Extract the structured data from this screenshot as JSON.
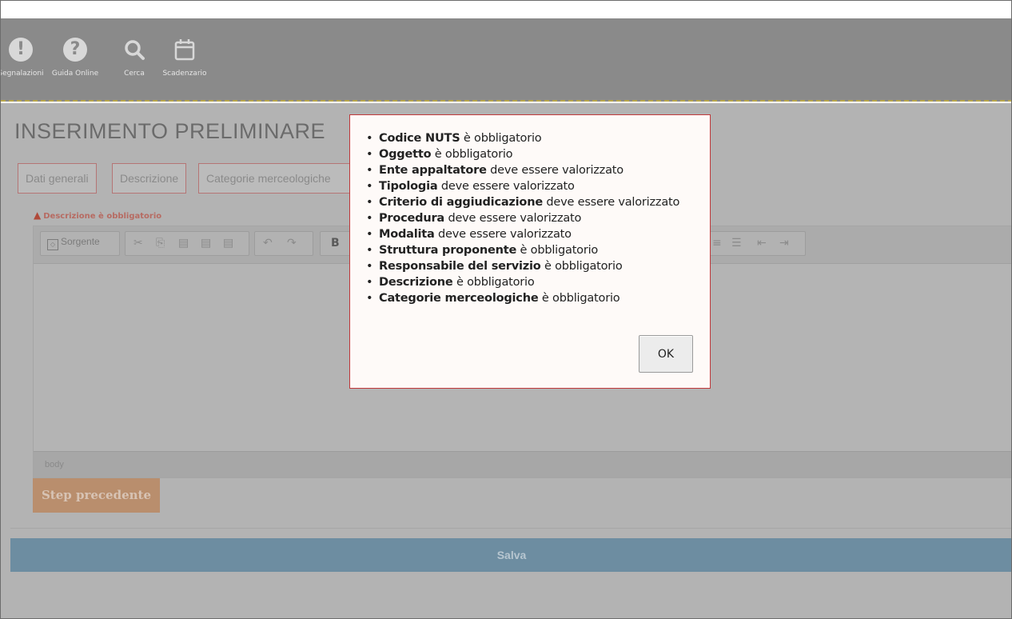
{
  "toolbar": {
    "items": [
      {
        "label": "Segnalazioni",
        "icon": "exclamation-icon"
      },
      {
        "label": "Guida Online",
        "icon": "question-icon"
      },
      {
        "label": "Cerca",
        "icon": "search-icon"
      },
      {
        "label": "Scadenzario",
        "icon": "calendar-icon"
      }
    ]
  },
  "page": {
    "title": "INSERIMENTO PRELIMINARE",
    "tabs": [
      {
        "label": "Dati generali"
      },
      {
        "label": "Descrizione"
      },
      {
        "label": "Categorie merceologiche"
      }
    ],
    "field_error": "Descrizione è obbligatorio",
    "editor": {
      "source_button": "Sorgente",
      "bold_label": "B",
      "status_path": "body"
    },
    "prev_button": "Step precedente",
    "save_button": "Salva"
  },
  "modal": {
    "errors": [
      {
        "field": "Codice NUTS",
        "message": "è obbligatorio"
      },
      {
        "field": "Oggetto",
        "message": "è obbligatorio"
      },
      {
        "field": "Ente appaltatore",
        "message": "deve essere valorizzato"
      },
      {
        "field": "Tipologia",
        "message": "deve essere valorizzato"
      },
      {
        "field": "Criterio di aggiudicazione",
        "message": "deve essere valorizzato"
      },
      {
        "field": "Procedura",
        "message": "deve essere valorizzato"
      },
      {
        "field": "Modalita",
        "message": "deve essere valorizzato"
      },
      {
        "field": "Struttura proponente",
        "message": "è obbligatorio"
      },
      {
        "field": "Responsabile del servizio",
        "message": "è obbligatorio"
      },
      {
        "field": "Descrizione",
        "message": "è obbligatorio"
      },
      {
        "field": "Categorie merceologiche",
        "message": "è obbligatorio"
      }
    ],
    "ok_label": "OK"
  },
  "colors": {
    "modal_border": "#c0393b",
    "overlay_bg": "#b3b3b3",
    "save_bar": "#6d8da1",
    "prev_button": "#b98e6d"
  }
}
